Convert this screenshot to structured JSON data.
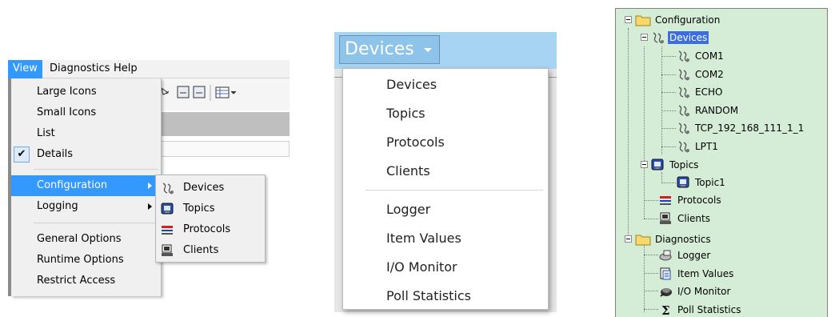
{
  "panel1": {
    "menubar": [
      "View",
      "Diagnostics",
      "Help"
    ],
    "view_menu": {
      "items": [
        "Large Icons",
        "Small Icons",
        "List",
        "Details"
      ],
      "checked": "Details",
      "group2": [
        "Configuration",
        "Logging"
      ],
      "group3": [
        "General Options",
        "Runtime Options",
        "Restrict Access"
      ],
      "highlighted": "Configuration"
    },
    "submenu": [
      {
        "label": "Devices",
        "icon": "device-icon"
      },
      {
        "label": "Topics",
        "icon": "topic-icon"
      },
      {
        "label": "Protocols",
        "icon": "protocol-icon"
      },
      {
        "label": "Clients",
        "icon": "client-icon"
      }
    ],
    "checkmark": "✔"
  },
  "panel2": {
    "button_label": "Devices",
    "group1": [
      "Devices",
      "Topics",
      "Protocols",
      "Clients"
    ],
    "group2": [
      "Logger",
      "Item Values",
      "I/O Monitor",
      "Poll Statistics"
    ]
  },
  "panel3": {
    "root1": "Configuration",
    "devices": "Devices",
    "device_items": [
      "COM1",
      "COM2",
      "ECHO",
      "RANDOM",
      "TCP_192_168_111_1_1",
      "LPT1"
    ],
    "topics": "Topics",
    "topic_items": [
      "Topic1"
    ],
    "protocols": "Protocols",
    "clients": "Clients",
    "root2": "Diagnostics",
    "diag_items": [
      "Logger",
      "Item Values",
      "I/O Monitor",
      "Poll Statistics"
    ]
  },
  "colors": {
    "menu_highlight": "#3399ff",
    "dropdown_bar": "#a8d4f4",
    "tree_background": "#d5ecd7",
    "tree_selection": "#3d6de0"
  }
}
